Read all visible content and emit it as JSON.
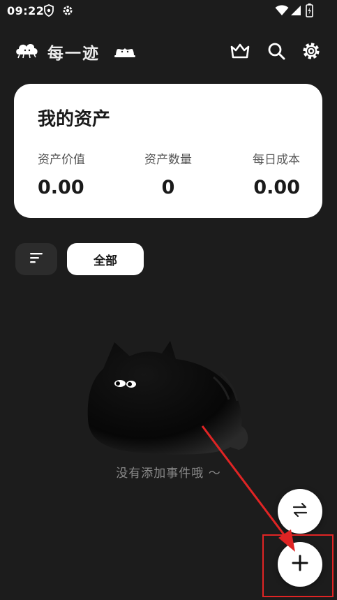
{
  "status_bar": {
    "time": "09:22",
    "icons": [
      "shield-icon",
      "gear-icon",
      "wifi-icon",
      "signal-icon",
      "battery-icon"
    ]
  },
  "header": {
    "title": "每一迹",
    "actions": [
      "crown-icon",
      "search-icon",
      "settings-icon"
    ]
  },
  "asset_card": {
    "title": "我的资产",
    "stats": [
      {
        "label": "资产价值",
        "value": "0.00"
      },
      {
        "label": "资产数量",
        "value": "0"
      },
      {
        "label": "每日成本",
        "value": "0.00"
      }
    ]
  },
  "filter": {
    "sort_icon": "sort-icon",
    "chip_label": "全部"
  },
  "empty_state": {
    "illustration": "black-cat-illustration",
    "text": "没有添加事件哦 ～"
  },
  "fabs": {
    "switch_icon": "swap-arrows-icon",
    "add_icon": "plus-icon"
  },
  "annotation": {
    "color": "#e02424",
    "type": "red-arrow-and-box-highlight"
  },
  "colors": {
    "background": "#1c1c1c",
    "card": "#ffffff",
    "accent_annotation": "#e02424"
  }
}
